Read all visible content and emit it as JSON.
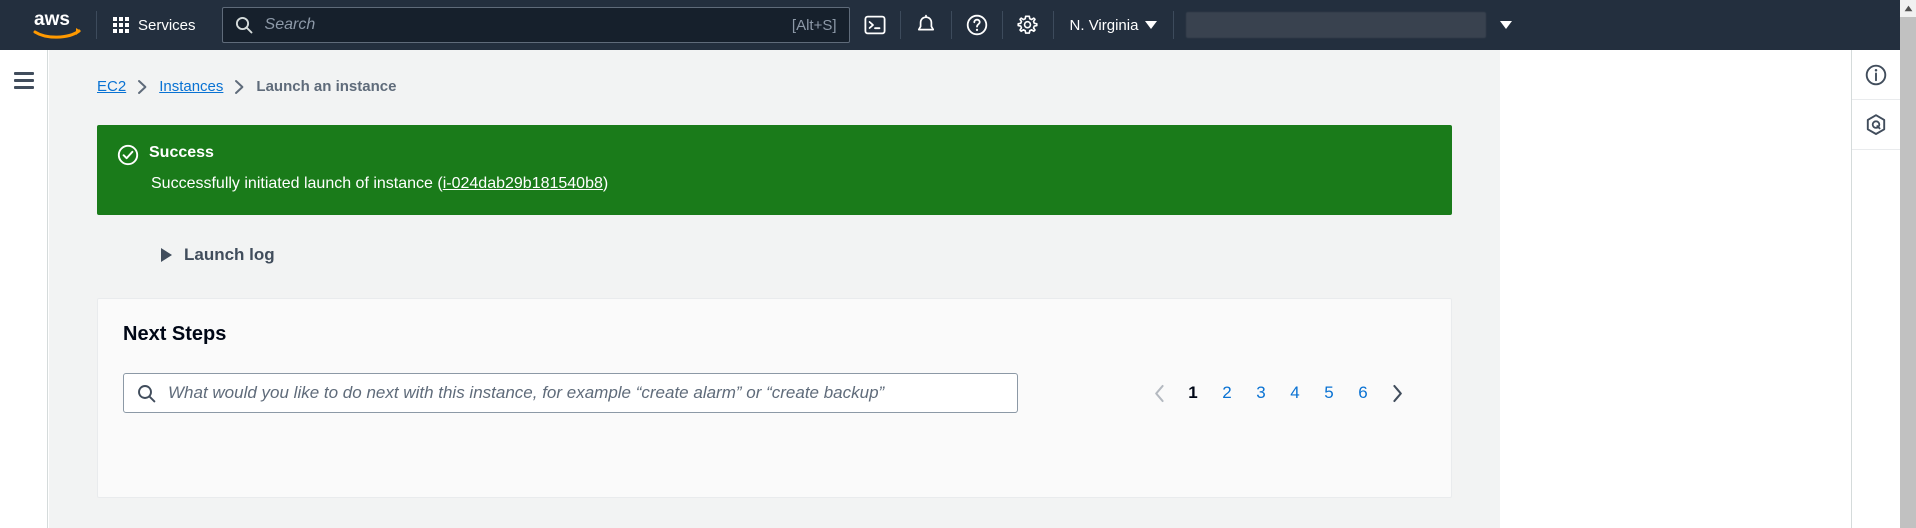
{
  "topnav": {
    "logo_alt": "aws",
    "services_label": "Services",
    "search": {
      "placeholder": "Search",
      "shortcut": "[Alt+S]"
    },
    "icons": [
      {
        "name": "cloudshell-icon"
      },
      {
        "name": "notifications-bell-icon"
      },
      {
        "name": "help-question-icon"
      },
      {
        "name": "settings-gear-icon"
      }
    ],
    "region": "N. Virginia",
    "account_label": ""
  },
  "breadcrumb": {
    "items": [
      {
        "label": "EC2",
        "link": true
      },
      {
        "label": "Instances",
        "link": true
      },
      {
        "label": "Launch an instance",
        "link": false
      }
    ],
    "separator": "›"
  },
  "banner": {
    "status": "success",
    "title": "Success",
    "message_prefix": "Successfully initiated launch of instance (",
    "instance_id": "i-024dab29b181540b8",
    "message_suffix": ")",
    "color": "#1a7b1a"
  },
  "launch_log": {
    "label": "Launch log",
    "expanded": false
  },
  "next_steps": {
    "title": "Next Steps",
    "search_placeholder": "What would you like to do next with this instance, for example “create alarm” or “create backup”",
    "search_value": "",
    "pagination": {
      "prev_label": "‹",
      "next_label": "›",
      "pages": [
        "1",
        "2",
        "3",
        "4",
        "5",
        "6"
      ],
      "current": "1"
    }
  },
  "right_rail": {
    "items": [
      {
        "name": "info-icon",
        "label": "Info"
      },
      {
        "name": "amazon-q-icon",
        "label": "Amazon Q"
      }
    ]
  },
  "left_rail": {
    "menu_label": "Menu"
  }
}
